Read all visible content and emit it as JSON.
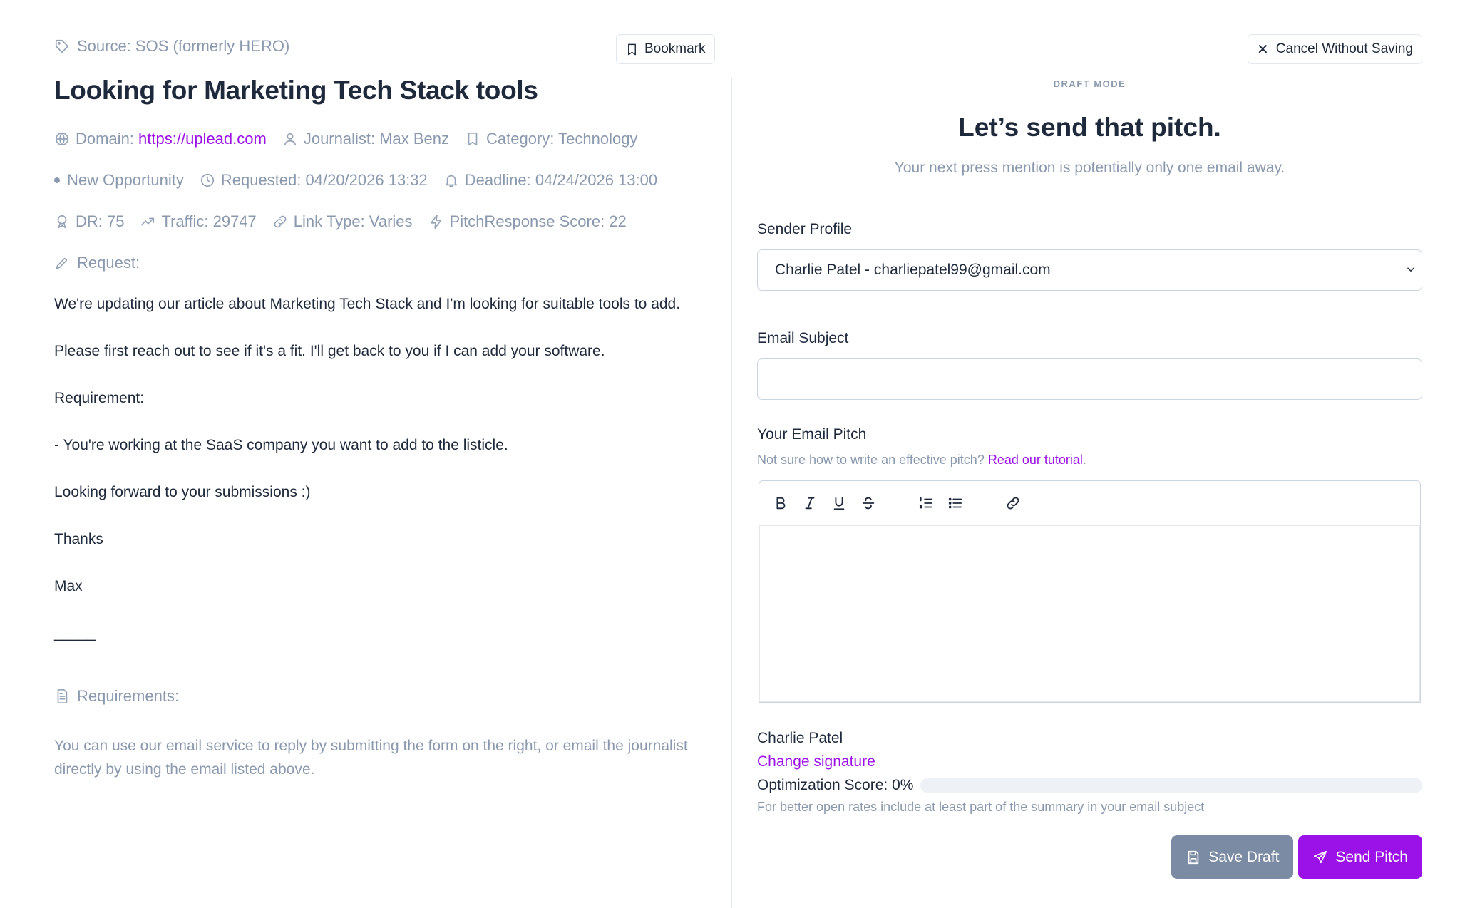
{
  "left": {
    "source": "Source: SOS (formerly HERO)",
    "bookmark_label": "Bookmark",
    "title": "Looking for Marketing Tech Stack tools",
    "meta1": {
      "domain_label": "Domain: ",
      "domain_url": "https://uplead.com",
      "journalist": "Journalist: Max Benz",
      "category": "Category: Technology"
    },
    "meta2": {
      "status": "New Opportunity",
      "requested": "Requested: 04/20/2026 13:32",
      "deadline": "Deadline: 04/24/2026 13:00"
    },
    "meta3": {
      "dr": "DR: 75",
      "traffic": "Traffic: 29747",
      "link_type": "Link Type: Varies",
      "score": "PitchResponse Score: 22"
    },
    "request_label": "Request:",
    "body": [
      "We're updating our article about Marketing Tech Stack and I'm looking for suitable tools to add.",
      "Please first reach out to see if it's a fit. I'll get back to you if I can add your software.",
      "Requirement:",
      "- You're working at the SaaS company you want to add to the listicle.",
      "Looking forward to your submissions :)",
      "Thanks",
      "Max",
      "_____"
    ],
    "requirements_label": "Requirements:",
    "footer_note": "You can use our email service to reply by submitting the form on the right, or email the journalist directly by using the email listed above."
  },
  "right": {
    "cancel_label": "Cancel Without Saving",
    "draft_mode": "DRAFT MODE",
    "headline": "Let’s send that pitch.",
    "subhead": "Your next press mention is potentially only one email away.",
    "sender_label": "Sender Profile",
    "sender_value": "Charlie Patel - charliepatel99@gmail.com",
    "subject_label": "Email Subject",
    "subject_value": "",
    "subject_placeholder": "",
    "pitch_label": "Your Email Pitch",
    "hint_prefix": "Not sure how to write an effective pitch? ",
    "hint_link": "Read our tutorial",
    "hint_suffix": ".",
    "signature_name": "Charlie Patel",
    "change_signature": "Change signature",
    "optimization_label": "Optimization Score: 0%",
    "optimization_value": 0,
    "optimization_hint": "For better open rates include at least part of the summary in your email subject",
    "save_draft": "Save Draft",
    "send_pitch": "Send Pitch"
  },
  "colors": {
    "accent": "#9b12e8",
    "muted": "#8a99ae",
    "save_button": "#7b8ba3"
  }
}
